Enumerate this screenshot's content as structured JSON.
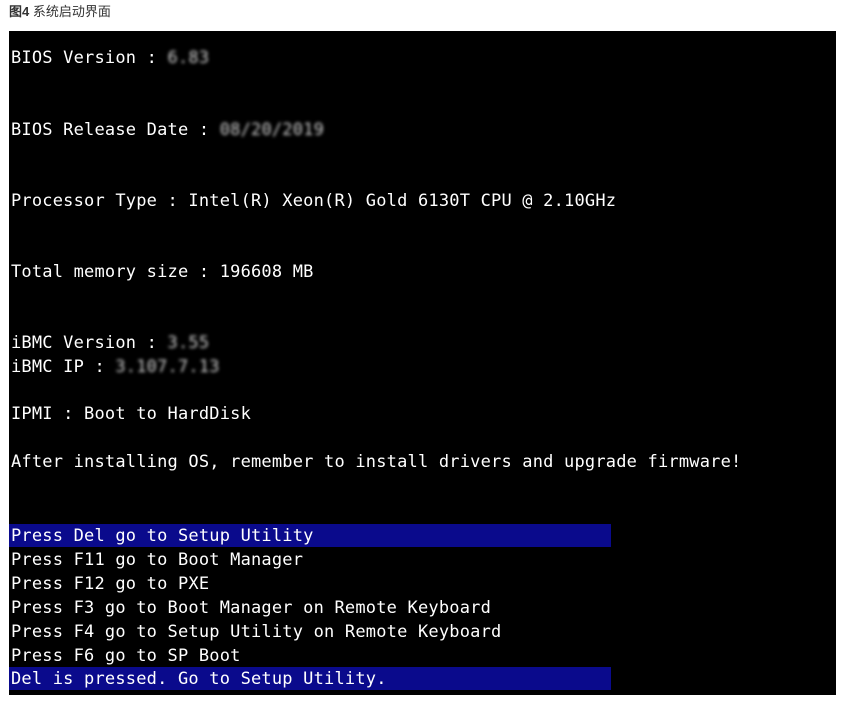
{
  "caption": {
    "label": "图4",
    "title": "系统启动界面"
  },
  "screen": {
    "bios_version": {
      "label": "BIOS Version : ",
      "value": "6.83"
    },
    "bios_release_date": {
      "label": "BIOS Release Date : ",
      "value": "08/20/2019"
    },
    "processor_type": "Processor Type : Intel(R) Xeon(R) Gold 6130T CPU @ 2.10GHz",
    "total_memory": "Total memory size : 196608 MB",
    "ibmc_version": {
      "label": "iBMC Version : ",
      "value": "3.55"
    },
    "ibmc_ip": {
      "label": "iBMC IP : ",
      "value": "3.107.7.13"
    },
    "ipmi": "IPMI : Boot to HardDisk",
    "notice": "After installing OS, remember to install drivers and upgrade firmware!",
    "menu": [
      "Press Del go to Setup Utility",
      "Press F11 go to Boot Manager",
      "Press F12 go to PXE",
      "Press F3 go to Boot Manager on Remote Keyboard",
      "Press F4 go to Setup Utility on Remote Keyboard",
      "Press F6 go to SP Boot"
    ],
    "status": "Del is pressed. Go to Setup Utility.",
    "colors": {
      "background": "#000000",
      "text": "#ffffff",
      "highlight": "#0a0a8c"
    }
  }
}
